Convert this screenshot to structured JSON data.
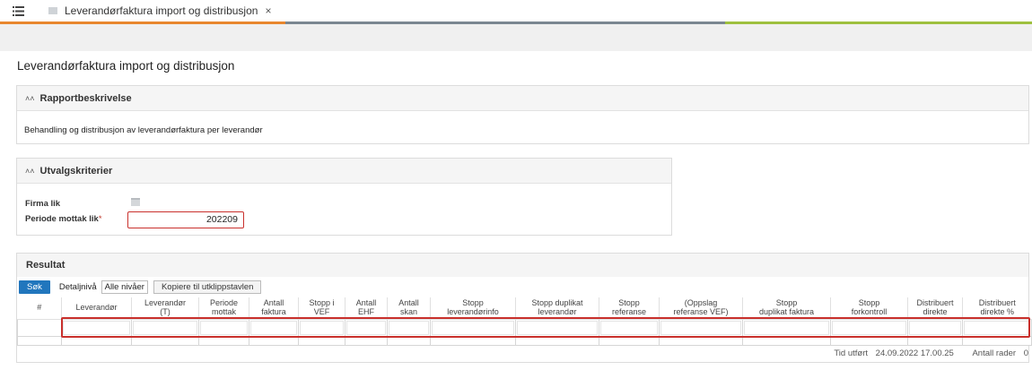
{
  "tab": {
    "title": "Leverandørfaktura import og distribusjon",
    "close": "×"
  },
  "strip_colors": [
    "#e8872e",
    "#7b8791",
    "#9ec03f"
  ],
  "page_title": "Leverandørfaktura import og distribusjon",
  "rapport": {
    "heading": "Rapportbeskrivelse",
    "description": "Behandling og distribusjon av leverandørfaktura per leverandør"
  },
  "utvalg": {
    "heading": "Utvalgskriterier",
    "firma_label": "Firma lik",
    "periode_label": "Periode mottak lik",
    "required_mark": "*",
    "periode_value": "202209"
  },
  "resultat": {
    "heading": "Resultat",
    "sok_label": "Søk",
    "detalj_label": "Detaljnivå",
    "alle_label": "Alle nivåer",
    "copy_label": "Kopiere til utklippstavlen",
    "columns": [
      [
        "#"
      ],
      [
        "Leverandør"
      ],
      [
        "Leverandør",
        "(T)"
      ],
      [
        "Periode",
        "mottak"
      ],
      [
        "Antall",
        "faktura"
      ],
      [
        "Stopp i",
        "VEF"
      ],
      [
        "Antall",
        "EHF"
      ],
      [
        "Antall",
        "skan"
      ],
      [
        "Stopp",
        "leverandørinfo"
      ],
      [
        "Stopp duplikat",
        "leverandør"
      ],
      [
        "Stopp",
        "referanse"
      ],
      [
        "(Oppslag",
        "referanse VEF)"
      ],
      [
        "Stopp",
        "duplikat faktura"
      ],
      [
        "Stopp",
        "forkontroll"
      ],
      [
        "Distribuert",
        "direkte"
      ],
      [
        "Distribuert",
        "direkte %"
      ]
    ],
    "footer_time_label": "Tid utført",
    "footer_time_value": "24.09.2022 17.00.25",
    "footer_rows_label": "Antall rader",
    "footer_rows_value": "0"
  },
  "icons": {
    "menu": "list-menu-icon",
    "page": "page-icon",
    "chevron": "chevron-up-icon"
  },
  "highlight_color": "#c9302c",
  "accent_color": "#2176bd"
}
